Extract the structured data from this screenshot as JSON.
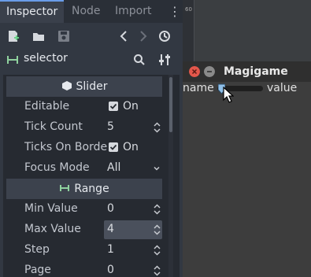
{
  "tabs": [
    {
      "label": "Inspector",
      "active": true
    },
    {
      "label": "Node",
      "active": false
    },
    {
      "label": "Import",
      "active": false
    }
  ],
  "toolbar": {
    "icons": [
      "new-resource-icon",
      "open-folder-icon",
      "save-icon",
      "history-back-icon",
      "history-forward-icon",
      "history-icon"
    ]
  },
  "path": {
    "node_name": "selector",
    "icons": [
      "node-type-icon",
      "search-icon",
      "tool-settings-icon"
    ]
  },
  "inspector": {
    "section_slider": "Slider",
    "section_range": "Range",
    "rows": {
      "editable": {
        "label": "Editable",
        "value": "On",
        "checked": true
      },
      "tick_count": {
        "label": "Tick Count",
        "value": "5"
      },
      "ticks_on_borders": {
        "label": "Ticks On Borde",
        "value": "On",
        "checked": true
      },
      "focus_mode": {
        "label": "Focus Mode",
        "value": "All"
      },
      "min_value": {
        "label": "Min Value",
        "value": "0"
      },
      "max_value": {
        "label": "Max Value",
        "value": "4"
      },
      "step": {
        "label": "Step",
        "value": "1"
      },
      "page": {
        "label": "Page",
        "value": "0"
      }
    }
  },
  "viewport": {
    "ruler_label": "60"
  },
  "game_window": {
    "title": "Magigame",
    "name_label": "name",
    "value_label": "value",
    "slider_value_fraction": 0.02
  },
  "colors": {
    "accent": "#699ce8",
    "close_button": "#e3574b",
    "minimize_button": "#8a8a8a"
  }
}
